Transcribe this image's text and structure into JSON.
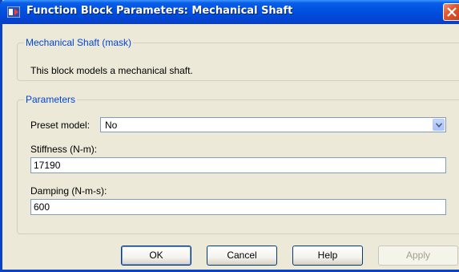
{
  "window": {
    "title": "Function Block Parameters: Mechanical Shaft"
  },
  "description_group": {
    "legend": "Mechanical Shaft (mask)",
    "text": "This block models a mechanical shaft."
  },
  "parameters_group": {
    "legend": "Parameters",
    "preset_label": "Preset model:",
    "preset_value": "No",
    "stiffness_label": "Stiffness (N-m):",
    "stiffness_value": "17190",
    "damping_label": "Damping (N-m-s):",
    "damping_value": "600"
  },
  "buttons": {
    "ok": "OK",
    "cancel": "Cancel",
    "help": "Help",
    "apply": "Apply"
  }
}
